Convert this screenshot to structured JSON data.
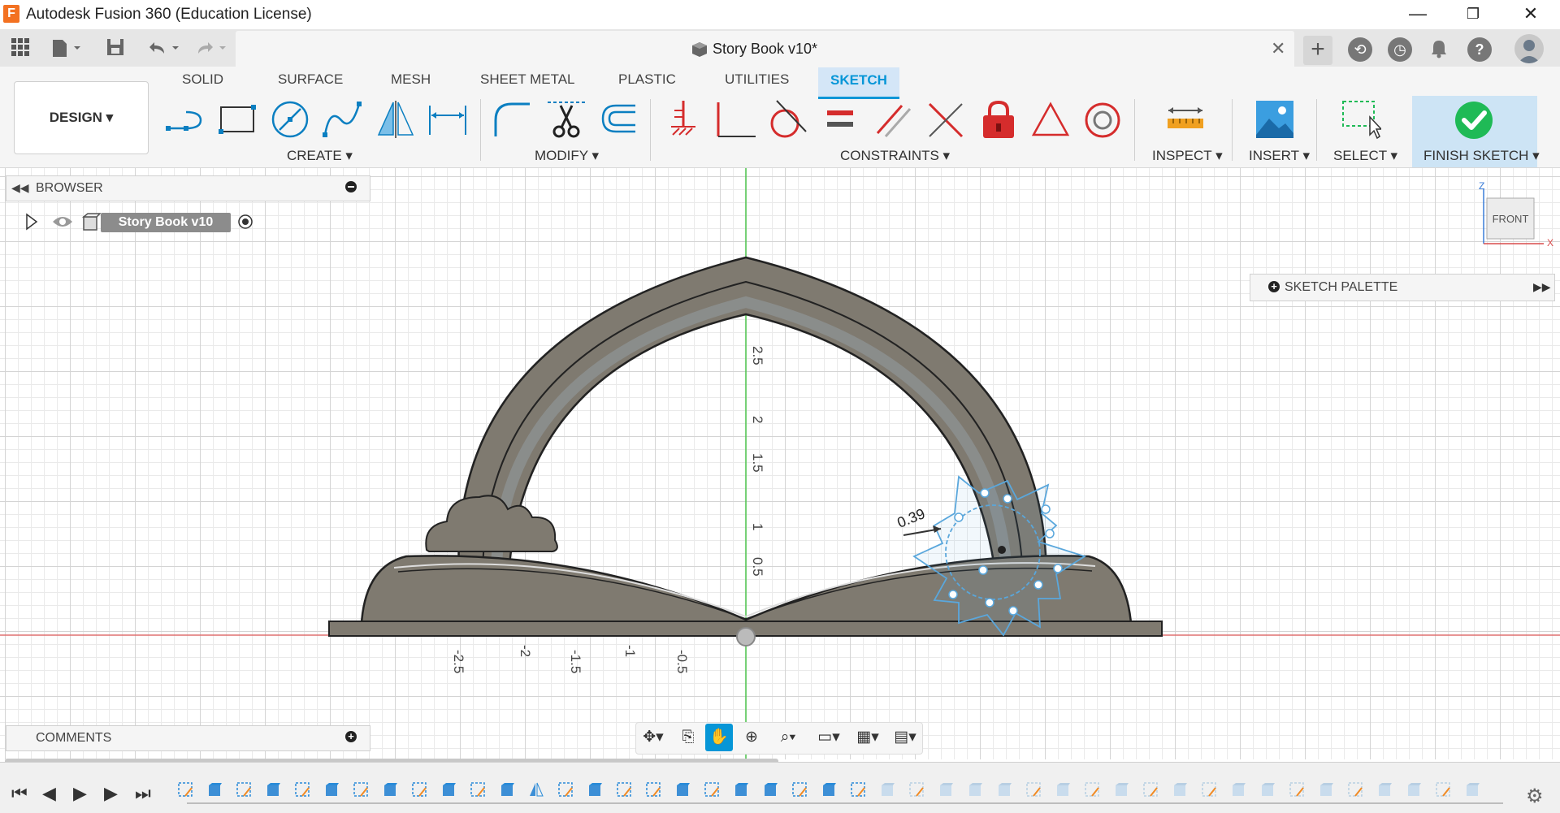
{
  "window": {
    "title": "Autodesk Fusion 360 (Education License)",
    "logo_letter": "F",
    "minimize": "—",
    "restore": "❐",
    "close": "✕"
  },
  "document": {
    "tab_title": "Story Book v10*",
    "close_glyph": "✕"
  },
  "workspace": {
    "label": "DESIGN ▾"
  },
  "ribbon_tabs": [
    "SOLID",
    "SURFACE",
    "MESH",
    "SHEET METAL",
    "PLASTIC",
    "UTILITIES",
    "SKETCH"
  ],
  "ribbon_groups": {
    "create": "CREATE ▾",
    "modify": "MODIFY ▾",
    "constraints": "CONSTRAINTS ▾",
    "inspect": "INSPECT ▾",
    "insert": "INSERT ▾",
    "select": "SELECT ▾",
    "finish": "FINISH SKETCH ▾"
  },
  "browser": {
    "title": "BROWSER",
    "root_node": "Story Book v10"
  },
  "comments": {
    "title": "COMMENTS"
  },
  "sketch_palette": {
    "title": "SKETCH PALETTE"
  },
  "viewcube": {
    "face": "FRONT",
    "axis_z": "Z",
    "axis_x": "X"
  },
  "dimension": {
    "value": "0.39"
  },
  "axis_ticks": {
    "horizontal": [
      "-2.5",
      "-2",
      "-1.5",
      "-1",
      "-0.5"
    ],
    "vertical": [
      "2.5",
      "2",
      "1.5",
      "1",
      "0.5"
    ]
  },
  "colors": {
    "accent": "#0696d7",
    "finish_green": "#1fba56",
    "constraint_red": "#d52c2c",
    "model_fill": "#7f7a70",
    "axis_green": "#4cc44c",
    "axis_red": "#e07070"
  }
}
